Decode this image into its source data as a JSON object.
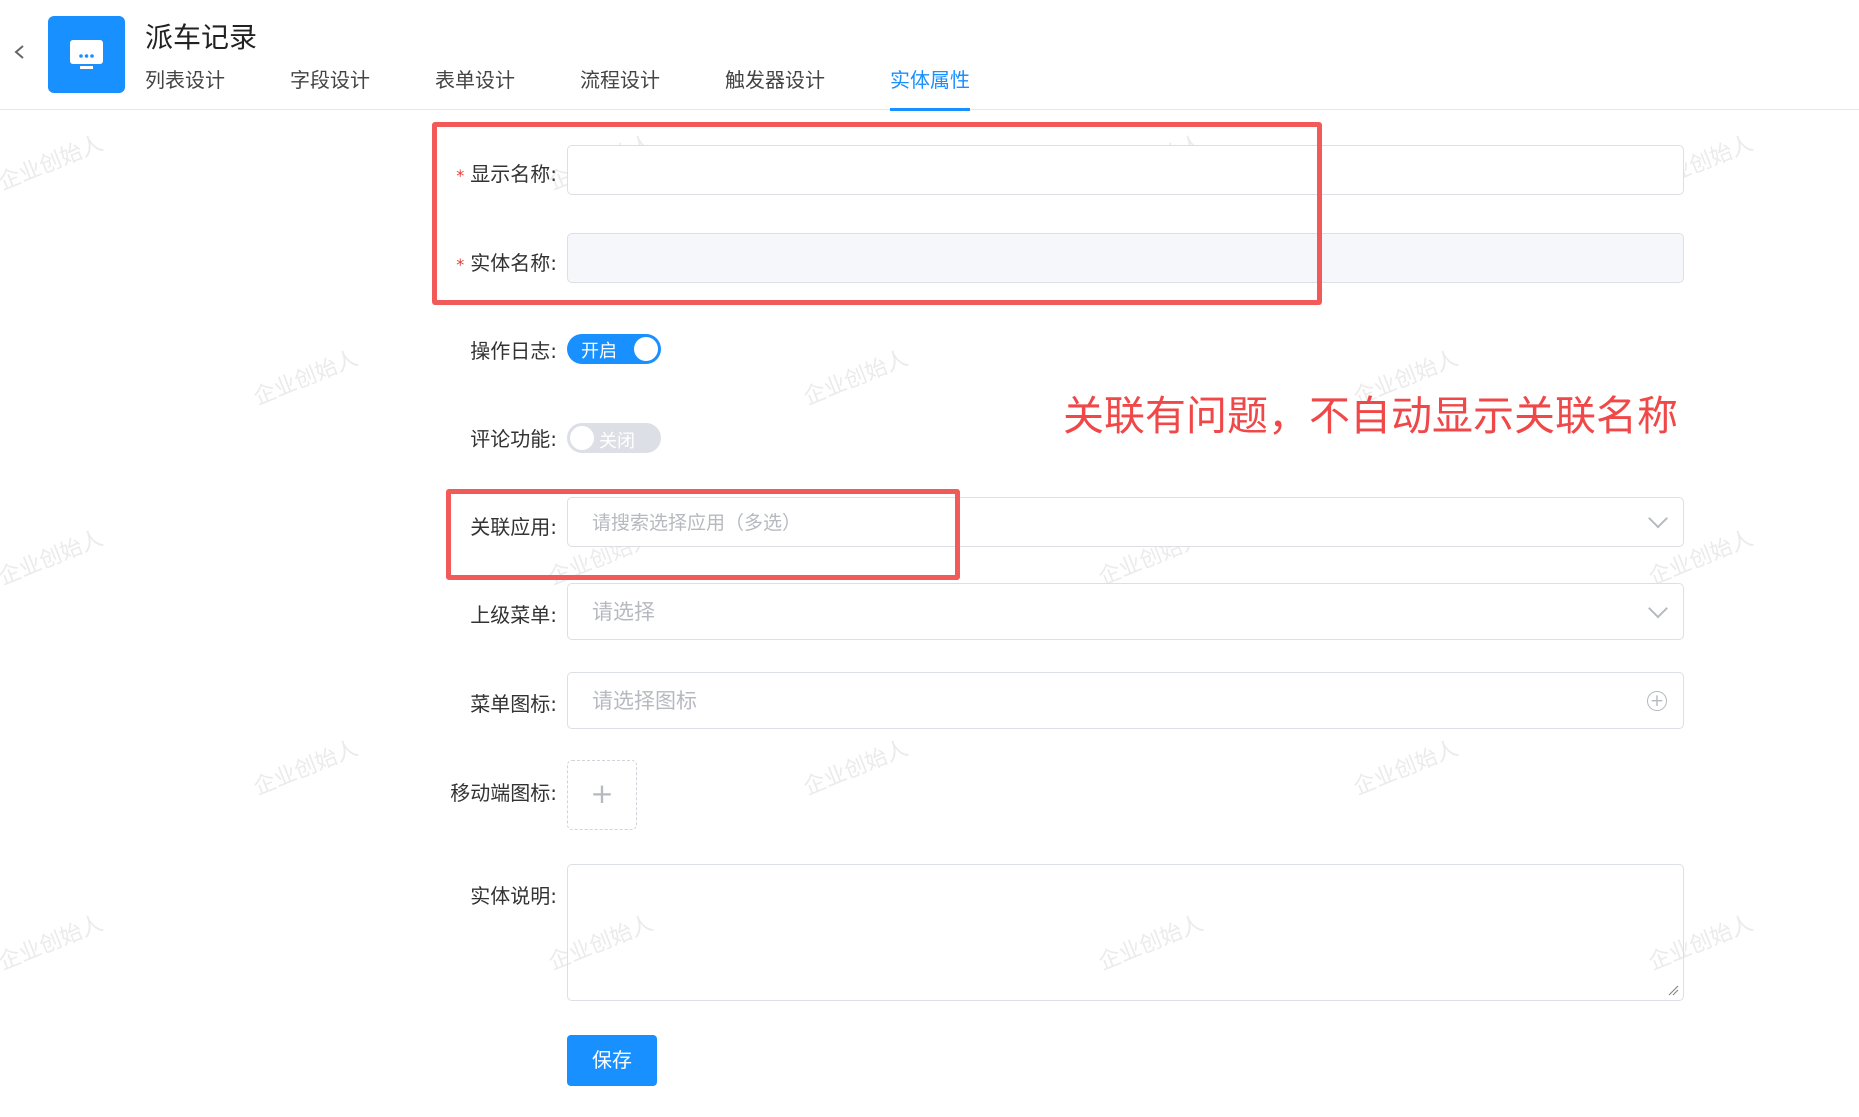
{
  "header": {
    "back_icon": "chevron-left-icon",
    "logo_icon": "monitor-app-icon",
    "logo_color": "#1890ff",
    "title": "派车记录",
    "tabs": [
      {
        "label": "列表设计",
        "active": false
      },
      {
        "label": "字段设计",
        "active": false
      },
      {
        "label": "表单设计",
        "active": false
      },
      {
        "label": "流程设计",
        "active": false
      },
      {
        "label": "触发器设计",
        "active": false
      },
      {
        "label": "实体属性",
        "active": true
      }
    ]
  },
  "form": {
    "display_name": {
      "label": "显示名称:",
      "required": "*",
      "value": ""
    },
    "entity_name": {
      "label": "实体名称:",
      "required": "*",
      "value": ""
    },
    "operation_log": {
      "label": "操作日志:",
      "switch_text": "开启",
      "on": true
    },
    "comment": {
      "label": "评论功能:",
      "switch_text": "关闭",
      "on": false
    },
    "related_apps": {
      "label": "关联应用:",
      "placeholder": "请搜索选择应用（多选）"
    },
    "parent_menu": {
      "label": "上级菜单:",
      "placeholder": "请选择"
    },
    "menu_icon": {
      "label": "菜单图标:",
      "placeholder": "请选择图标"
    },
    "mobile_icon": {
      "label": "移动端图标:",
      "upload_symbol": "+"
    },
    "description": {
      "label": "实体说明:",
      "value": ""
    },
    "save_label": "保存"
  },
  "annotation": {
    "text": "关联有问题，不自动显示关联名称",
    "color": "#f04848"
  },
  "watermark": "企业创始人",
  "accent_color": "#1890ff"
}
